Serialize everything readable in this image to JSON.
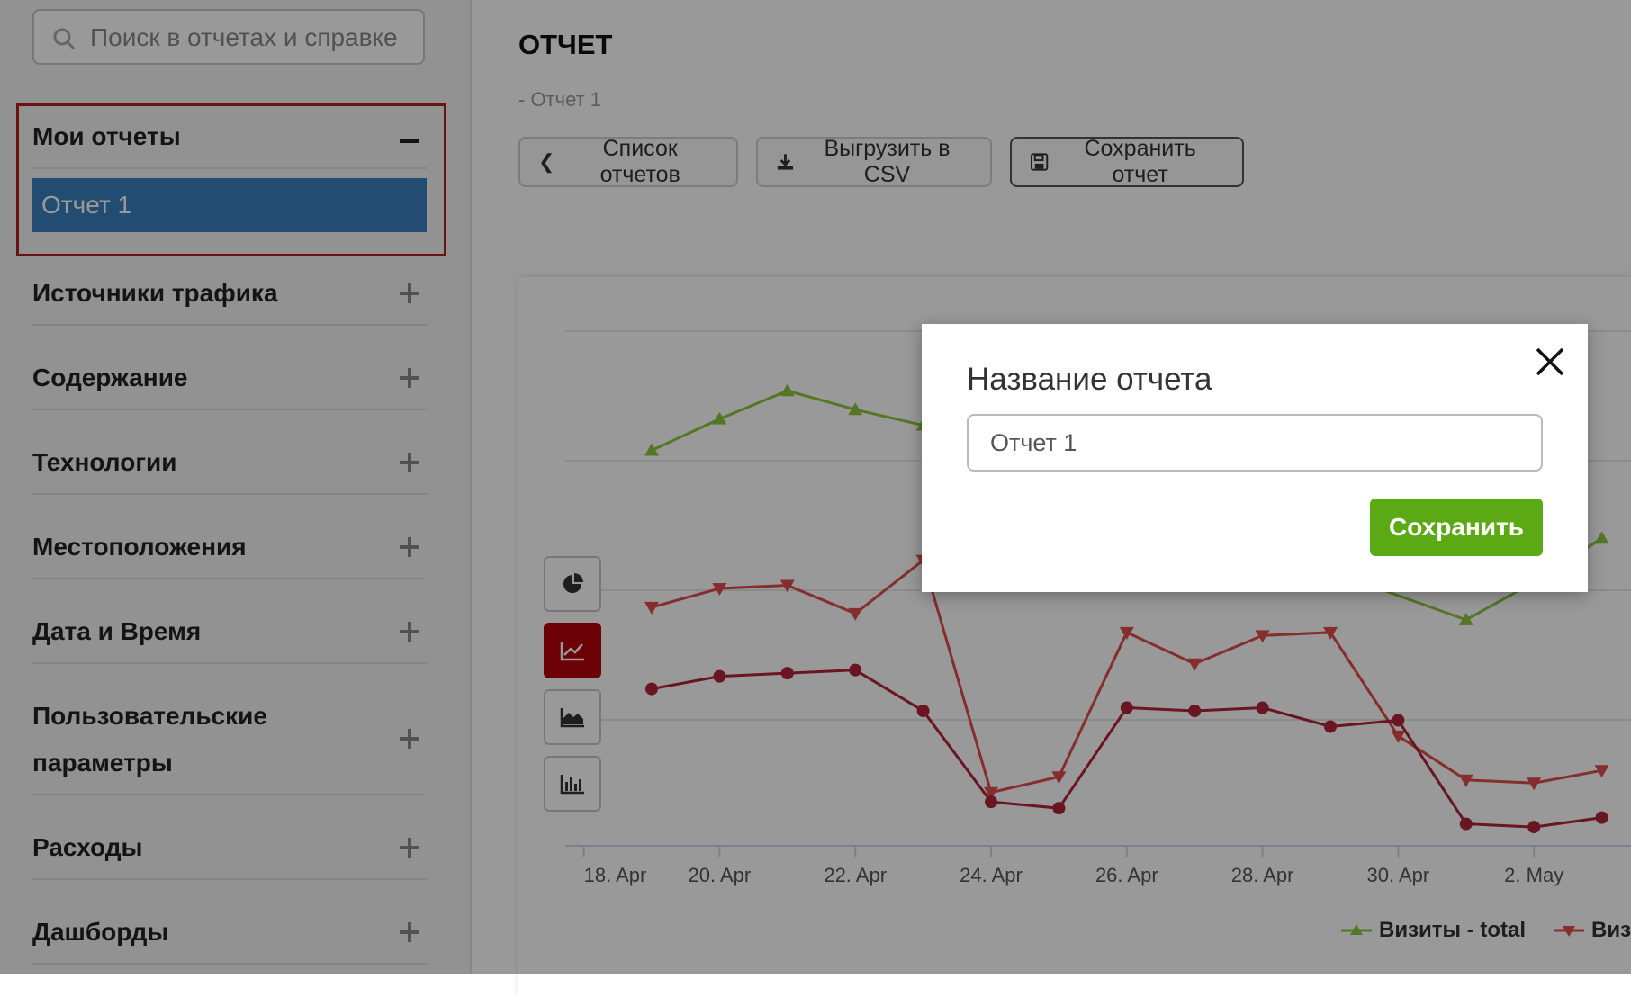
{
  "colors": {
    "accent_blue": "#3a7fbf",
    "highlight_red": "#b3201b",
    "chart_active": "#b3000b",
    "save_green": "#5aa915",
    "series_green": "#8cc63f",
    "series_red": "#e04b4b",
    "series_darkred": "#b0243a"
  },
  "search": {
    "placeholder": "Поиск в отчетах и справке",
    "icon": "search-icon"
  },
  "sidebar": {
    "my_reports": {
      "label": "Мои отчеты",
      "expanded": true,
      "items": [
        {
          "label": "Отчет 1"
        }
      ]
    },
    "sections": [
      {
        "label": "Источники трафика"
      },
      {
        "label": "Содержание"
      },
      {
        "label": "Технологии"
      },
      {
        "label": "Местоположения"
      },
      {
        "label": "Дата и Время"
      },
      {
        "label": "Пользовательские параметры"
      },
      {
        "label": "Расходы"
      },
      {
        "label": "Дашборды"
      }
    ]
  },
  "header": {
    "title": "ОТЧЕТ",
    "subtitle": "- Отчет 1"
  },
  "toolbar": {
    "list_label": "Список отчетов",
    "csv_label": "Выгрузить в CSV",
    "save_label": "Сохранить отчет"
  },
  "chart_types": [
    "pie-icon",
    "line-chart-icon",
    "area-chart-icon",
    "bar-chart-icon"
  ],
  "chart_data": {
    "type": "line",
    "xlabel": "",
    "ylabel": "",
    "x_tick_labels": [
      "18. Apr",
      "20. Apr",
      "22. Apr",
      "24. Apr",
      "26. Apr",
      "28. Apr",
      "30. Apr",
      "2. May"
    ],
    "x_dates": [
      "19. Apr",
      "20. Apr",
      "21. Apr",
      "22. Apr",
      "23. Apr",
      "24. Apr",
      "25. Apr",
      "26. Apr",
      "27. Apr",
      "28. Apr",
      "29. Apr",
      "30. Apr",
      "1. May",
      "2. May",
      "3. May"
    ],
    "series": [
      {
        "name": "Визиты - total",
        "color": "#8cc63f",
        "marker": "triangle-up",
        "values": [
          62,
          72,
          81,
          75,
          70,
          null,
          null,
          null,
          null,
          null,
          null,
          null,
          8,
          20,
          34
        ]
      },
      {
        "name": "Виз",
        "color": "#e04b4b",
        "marker": "triangle-down",
        "values": [
          12,
          18,
          19,
          10,
          27,
          -47,
          -42,
          4,
          -6,
          3,
          4,
          -29,
          -43,
          -44,
          -40
        ]
      },
      {
        "values": [
          -14,
          -10,
          -9,
          -8,
          -21,
          -50,
          -52,
          -20,
          -21,
          -20,
          -26,
          -24,
          -57,
          -58,
          -55
        ],
        "color": "#b0243a",
        "marker": "circle"
      }
    ]
  },
  "modal": {
    "title": "Название отчета",
    "input_value": "Отчет 1",
    "save_label": "Сохранить",
    "close_icon": "close-icon"
  }
}
